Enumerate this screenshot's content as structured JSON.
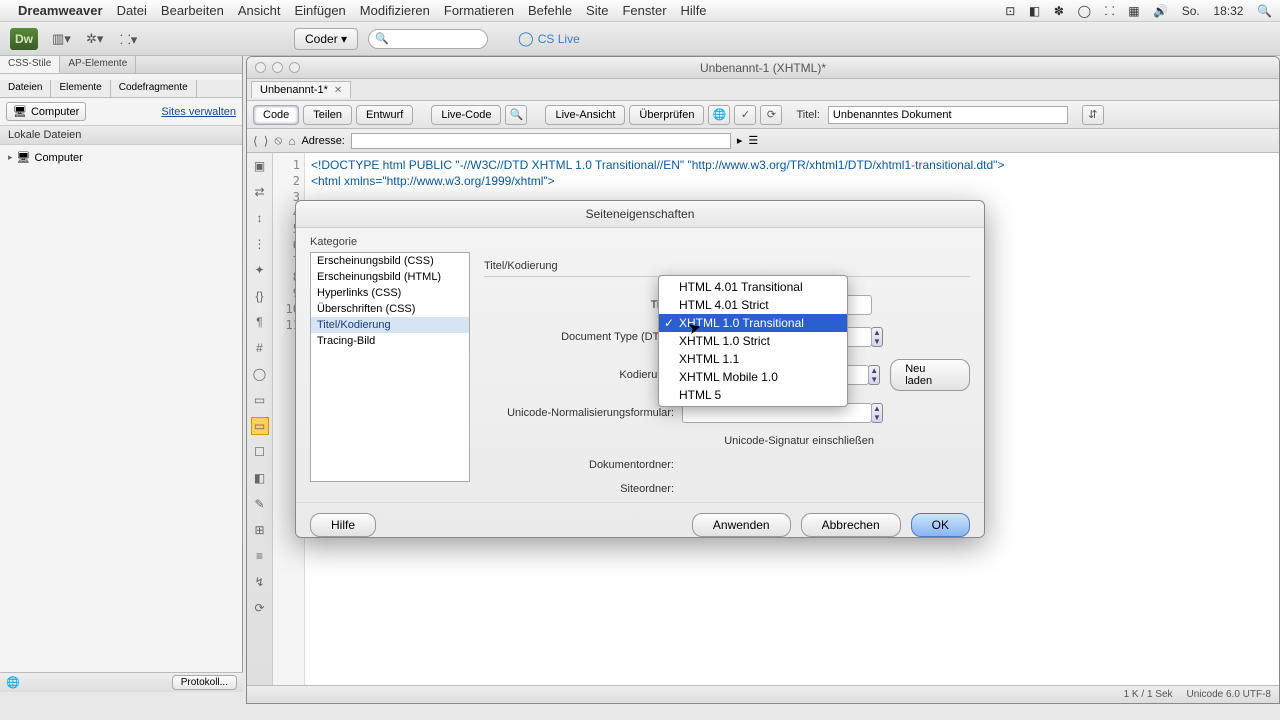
{
  "menubar": {
    "app": "Dreamweaver",
    "items": [
      "Datei",
      "Bearbeiten",
      "Ansicht",
      "Einfügen",
      "Modifizieren",
      "Formatieren",
      "Befehle",
      "Site",
      "Fenster",
      "Hilfe"
    ],
    "clock_day": "So.",
    "clock_time": "18:32"
  },
  "toolbar": {
    "logo": "Dw",
    "coder": "Coder ▾",
    "cslive": "CS Live"
  },
  "left_panel": {
    "tabs1": [
      "CSS-Stile",
      "AP-Elemente"
    ],
    "tabs2": [
      "Dateien",
      "Elemente",
      "Codefragmente"
    ],
    "computer_select": "Computer",
    "sites_link": "Sites verwalten",
    "local_header": "Lokale Dateien",
    "tree_root": "Computer",
    "protokoll": "Protokoll..."
  },
  "doc": {
    "window_title": "Unbenannt-1 (XHTML)*",
    "tab_name": "Unbenannt-1*",
    "views": {
      "code": "Code",
      "teilen": "Teilen",
      "entwurf": "Entwurf",
      "livecode": "Live-Code",
      "liveansicht": "Live-Ansicht",
      "ueberpruefen": "Überprüfen"
    },
    "titel_label": "Titel:",
    "titel_value": "Unbenanntes Dokument",
    "adresse_label": "Adresse:",
    "code_line1": "<!DOCTYPE html PUBLIC \"-//W3C//DTD XHTML 1.0 Transitional//EN\" \"http://www.w3.org/TR/xhtml1/DTD/xhtml1-transitional.dtd\">",
    "code_line2": "<html xmlns=\"http://www.w3.org/1999/xhtml\">",
    "status_size": "1 K / 1 Sek",
    "status_enc": "Unicode 6.0 UTF-8"
  },
  "dialog": {
    "title": "Seiteneigenschaften",
    "kategorie_label": "Kategorie",
    "categories": [
      "Erscheinungsbild (CSS)",
      "Erscheinungsbild (HTML)",
      "Hyperlinks (CSS)",
      "Überschriften (CSS)",
      "Titel/Kodierung",
      "Tracing-Bild"
    ],
    "selected_category_index": 4,
    "section": "Titel/Kodierung",
    "fields": {
      "titel": "Titel:",
      "dtd": "Document Type (DTD):",
      "kodierung": "Kodierung:",
      "unicode": "Unicode-Normalisierungsformular:",
      "dokordner": "Dokumentordner:",
      "siteordner": "Siteordner:",
      "bom_checkbox": "Unicode-Signatur einschließen"
    },
    "buttons": {
      "neuladen": "Neu laden",
      "hilfe": "Hilfe",
      "anwenden": "Anwenden",
      "abbrechen": "Abbrechen",
      "ok": "OK"
    }
  },
  "dropdown": {
    "options": [
      "HTML 4.01 Transitional",
      "HTML 4.01 Strict",
      "XHTML 1.0 Transitional",
      "XHTML 1.0 Strict",
      "XHTML 1.1",
      "XHTML Mobile 1.0",
      "HTML 5"
    ],
    "selected_index": 2
  }
}
